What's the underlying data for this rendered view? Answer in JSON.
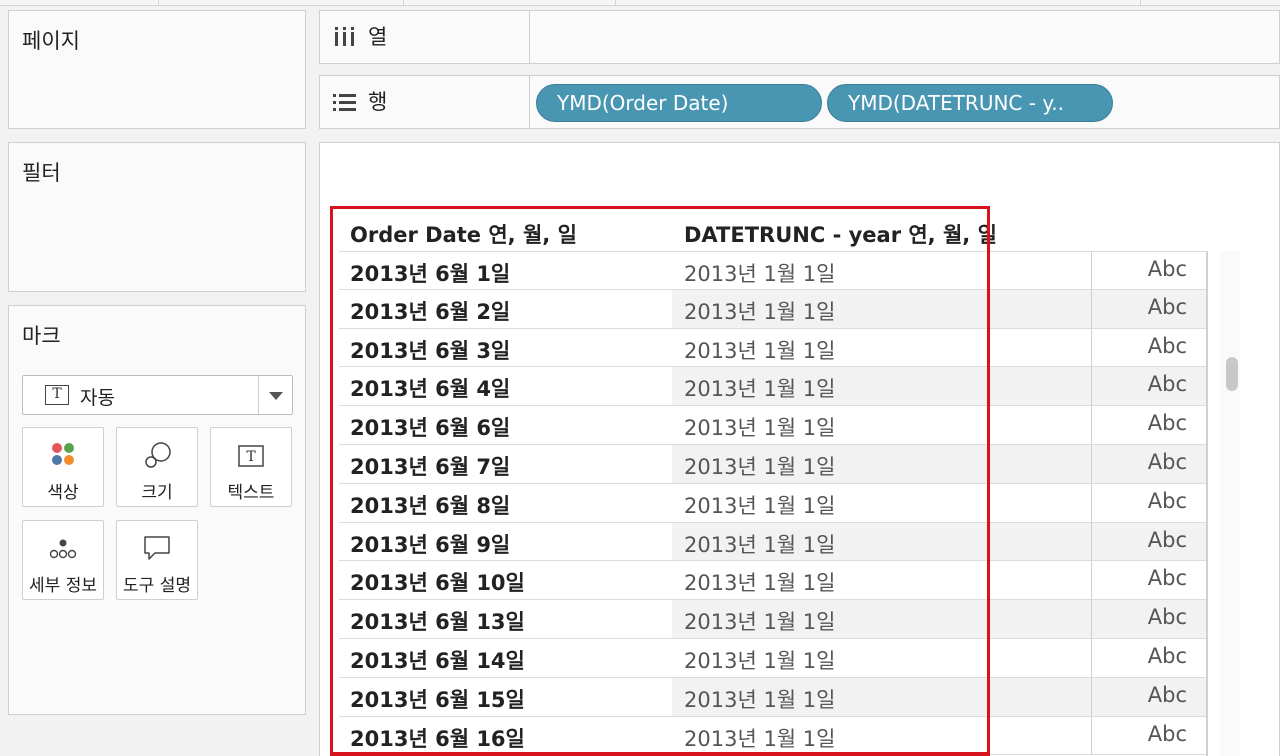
{
  "pages_panel": {
    "title": "페이지"
  },
  "filters_panel": {
    "title": "필터"
  },
  "marks_panel": {
    "title": "마크",
    "mark_type": {
      "icon": "text-icon",
      "icon_glyph": "T",
      "label": "자동"
    },
    "cards": [
      {
        "label": "색상",
        "icon": "color-icon"
      },
      {
        "label": "크기",
        "icon": "size-icon"
      },
      {
        "label": "텍스트",
        "icon": "text-icon",
        "icon_glyph": "T"
      },
      {
        "label": "세부 정보",
        "icon": "detail-icon"
      },
      {
        "label": "도구 설명",
        "icon": "tooltip-icon"
      }
    ],
    "color_dots": [
      "#e15759",
      "#59a14f",
      "#4e79a7",
      "#f28e2b"
    ]
  },
  "shelves": {
    "columns": {
      "label": "열",
      "icon": "columns-icon"
    },
    "rows": {
      "label": "행",
      "icon": "rows-icon",
      "pills": [
        "YMD(Order Date)",
        "YMD(DATETRUNC - y.."
      ]
    }
  },
  "table": {
    "headers": [
      "Order Date 연, 월, 일",
      "DATETRUNC - year 연, 월, 일"
    ],
    "rows": [
      {
        "order_date": "2013년 6월 1일",
        "datetrunc": "2013년 1월 1일",
        "value": "Abc"
      },
      {
        "order_date": "2013년 6월 2일",
        "datetrunc": "2013년 1월 1일",
        "value": "Abc"
      },
      {
        "order_date": "2013년 6월 3일",
        "datetrunc": "2013년 1월 1일",
        "value": "Abc"
      },
      {
        "order_date": "2013년 6월 4일",
        "datetrunc": "2013년 1월 1일",
        "value": "Abc"
      },
      {
        "order_date": "2013년 6월 6일",
        "datetrunc": "2013년 1월 1일",
        "value": "Abc"
      },
      {
        "order_date": "2013년 6월 7일",
        "datetrunc": "2013년 1월 1일",
        "value": "Abc"
      },
      {
        "order_date": "2013년 6월 8일",
        "datetrunc": "2013년 1월 1일",
        "value": "Abc"
      },
      {
        "order_date": "2013년 6월 9일",
        "datetrunc": "2013년 1월 1일",
        "value": "Abc"
      },
      {
        "order_date": "2013년 6월 10일",
        "datetrunc": "2013년 1월 1일",
        "value": "Abc"
      },
      {
        "order_date": "2013년 6월 13일",
        "datetrunc": "2013년 1월 1일",
        "value": "Abc"
      },
      {
        "order_date": "2013년 6월 14일",
        "datetrunc": "2013년 1월 1일",
        "value": "Abc"
      },
      {
        "order_date": "2013년 6월 15일",
        "datetrunc": "2013년 1월 1일",
        "value": "Abc"
      },
      {
        "order_date": "2013년 6월 16일",
        "datetrunc": "2013년 1월 1일",
        "value": "Abc"
      }
    ]
  },
  "colors": {
    "pill": "#4996b2",
    "highlight": "#d7141e"
  }
}
